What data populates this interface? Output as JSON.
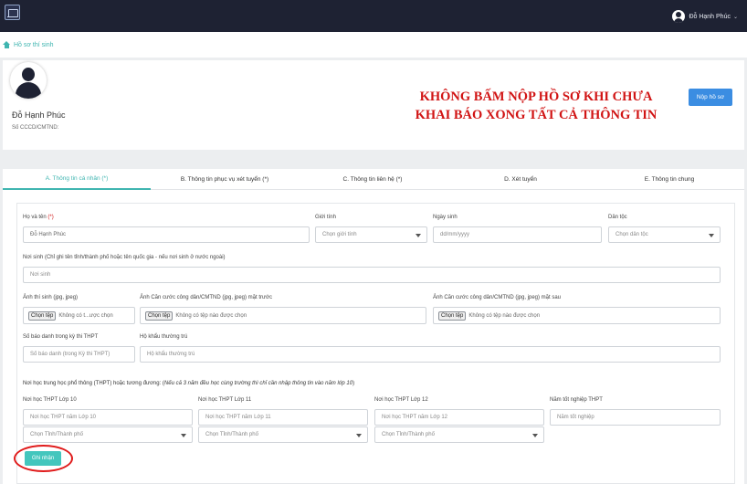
{
  "header": {
    "logo_icon": "crest-logo-icon",
    "user_name": "Đỗ Hạnh Phúc",
    "chevron": "⌄"
  },
  "breadcrumb": {
    "home_icon": "home-icon",
    "label": "Hồ sơ thí sinh"
  },
  "profile": {
    "name": "Đỗ Hạnh Phúc",
    "id_label": "Số CCCD/CMTND:",
    "warning_line1": "KHÔNG BẤM NỘP HỒ SƠ KHI CHƯA",
    "warning_line2": "KHAI BÁO XONG TẤT CẢ THÔNG TIN",
    "submit_label": "Nộp hồ sơ",
    "warning_color": "#d11414",
    "accent_color": "#3fb5b0"
  },
  "tabs": [
    {
      "label": "A. Thông tin cá nhân (*)",
      "active": true
    },
    {
      "label": "B. Thông tin phục vụ xét tuyển (*)",
      "active": false
    },
    {
      "label": "C. Thông tin liên hệ (*)",
      "active": false
    },
    {
      "label": "D. Xét tuyển",
      "active": false
    },
    {
      "label": "E. Thông tin chung",
      "active": false
    }
  ],
  "form": {
    "fullname_label": "Họ và tên",
    "required_mark": "(*)",
    "fullname_value": "Đỗ Hạnh Phúc",
    "gender_label": "Giới tính",
    "gender_value": "Chọn giới tính",
    "dob_label": "Ngày sinh",
    "dob_placeholder": "dd/mm/yyyy",
    "ethnic_label": "Dân tộc",
    "ethnic_value": "Chọn dân tộc",
    "birthplace_label": "Nơi sinh (Chỉ ghi tên tỉnh/thành phố hoặc tên quốc gia - nếu nơi sinh ở nước ngoài)",
    "birthplace_placeholder": "Nơi sinh",
    "photo_label": "Ảnh thí sinh (jpg, jpeg)",
    "photo_btn": "Chọn tệp",
    "photo_status": "Không có t...ược chọn",
    "id_front_label": "Ảnh Căn cước công dân/CMTND (jpg, jpeg) mặt trước",
    "id_front_btn": "Chọn tệp",
    "id_front_status": "Không có tệp nào được chọn",
    "id_back_label": "Ảnh Căn cước công dân/CMTND (jpg, jpeg) mặt sau",
    "id_back_btn": "Chọn tệp",
    "id_back_status": "Không có tệp nào được chọn",
    "sbd_label": "Số báo danh trong kỳ thi THPT",
    "sbd_placeholder": "Số báo danh (trong Kỳ thi THPT)",
    "household_label": "Hộ khẩu thường trú",
    "household_placeholder": "Hộ khẩu thường trú",
    "school_note_prefix": "Nơi học trung học phổ thông (THPT) hoặc tương đương: (",
    "school_note_italic": "Nếu cả 3 năm đều học cùng trường thì chỉ cần nhập thông tin vào năm lớp 10",
    "school_note_suffix": ")",
    "g10_label": "Nơi học THPT Lớp 10",
    "g10_placeholder": "Nơi học THPT năm Lớp 10",
    "g10_province": "Chọn Tỉnh/Thành phố",
    "g11_label": "Nơi học THPT Lớp 11",
    "g11_placeholder": "Nơi học THPT năm Lớp 11",
    "g11_province": "Chọn Tỉnh/Thành phố",
    "g12_label": "Nơi học THPT Lớp 12",
    "g12_placeholder": "Nơi học THPT năm Lớp 12",
    "g12_province": "Chọn Tỉnh/Thành phố",
    "grad_label": "Năm tốt nghiệp THPT",
    "grad_placeholder": "Năm tốt nghiệp",
    "save_label": "Ghi nhận"
  }
}
